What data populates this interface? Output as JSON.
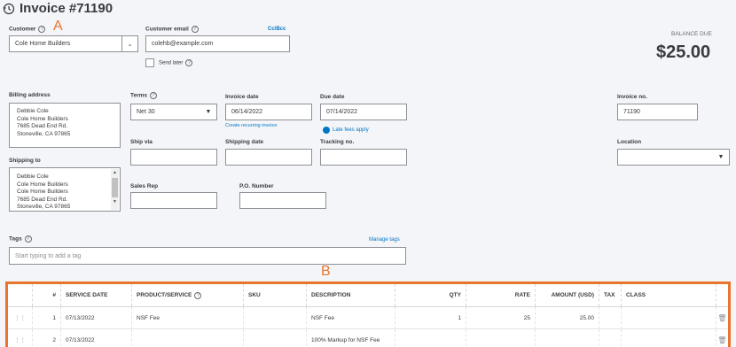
{
  "header": {
    "title": "Invoice #71190",
    "history_icon": "history-icon"
  },
  "annotations": {
    "a": "A",
    "b": "B"
  },
  "customer": {
    "label": "Customer",
    "value": "Cole Home Builders"
  },
  "customer_email": {
    "label": "Customer email",
    "value": "colehb@example.com",
    "ccbcc": "Cc/Bcc"
  },
  "send_later": {
    "label": "Send later",
    "checked": false
  },
  "balance": {
    "label": "BALANCE DUE",
    "amount": "$25.00"
  },
  "billing": {
    "label": "Billing address",
    "lines": [
      "Debbie Cole",
      "Cole Home Builders",
      "7685 Dead End Rd.",
      "Stoneville, CA 97865"
    ]
  },
  "shipping_to": {
    "label": "Shipping to",
    "lines": [
      "Debbie Cole",
      "Cole Home Builders",
      "Cole Home Builders",
      "7685 Dead End Rd.",
      "Stoneville, CA 97865"
    ]
  },
  "terms": {
    "label": "Terms",
    "value": "Net 30"
  },
  "invoice_date": {
    "label": "Invoice date",
    "value": "06/14/2022",
    "recurring_link": "Create recurring invoice"
  },
  "due_date": {
    "label": "Due date",
    "value": "07/14/2022",
    "late_fees": "Late fees apply"
  },
  "invoice_no": {
    "label": "Invoice no.",
    "value": "71190"
  },
  "ship_via": {
    "label": "Ship via",
    "value": ""
  },
  "shipping_date": {
    "label": "Shipping date",
    "value": ""
  },
  "tracking_no": {
    "label": "Tracking no.",
    "value": ""
  },
  "location": {
    "label": "Location",
    "value": ""
  },
  "sales_rep": {
    "label": "Sales Rep",
    "value": ""
  },
  "po_number": {
    "label": "P.O. Number",
    "value": ""
  },
  "tags": {
    "label": "Tags",
    "manage": "Manage tags",
    "placeholder": "Start typing to add a tag"
  },
  "table": {
    "headers": [
      "#",
      "SERVICE DATE",
      "PRODUCT/SERVICE",
      "SKU",
      "DESCRIPTION",
      "QTY",
      "RATE",
      "AMOUNT (USD)",
      "TAX",
      "CLASS"
    ],
    "rows": [
      {
        "num": "1",
        "date": "07/13/2022",
        "product": "NSF Fee",
        "sku": "",
        "description": "NSF Fee",
        "qty": "1",
        "rate": "25",
        "amount": "25.00",
        "tax": "",
        "class": ""
      },
      {
        "num": "2",
        "date": "07/13/2022",
        "product": "",
        "sku": "",
        "description": "100% Markup for NSF Fee",
        "qty": "",
        "rate": "",
        "amount": "",
        "tax": "",
        "class": ""
      }
    ]
  }
}
